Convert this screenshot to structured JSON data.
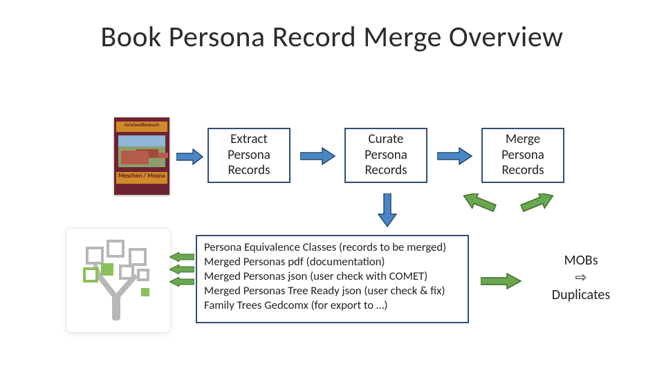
{
  "title": "Book Persona Record Merge Overview",
  "book": {
    "top_label": "Ortsfamilienbuch",
    "bottom_label": "Meschen / Moșna"
  },
  "steps": {
    "extract": {
      "l1": "Extract",
      "l2": "Persona",
      "l3": "Records"
    },
    "curate": {
      "l1": "Curate",
      "l2": "Persona",
      "l3": "Records"
    },
    "merge": {
      "l1": "Merge",
      "l2": "Persona",
      "l3": "Records"
    }
  },
  "outputs_text": "Persona Equivalence Classes (records to be merged)\nMerged Personas pdf (documentation)\nMerged Personas json (user check with COMET)\nMerged Personas Tree Ready json (user check & fix)\nFamily Trees Gedcomx (for export to …)",
  "mobs": {
    "l1": "MOBs",
    "l2": "⇨",
    "l3": "Duplicates"
  },
  "colors": {
    "arrow_blue": "#4a86c5",
    "arrow_green": "#6aa84f",
    "arrow_dark": "#244a6b",
    "border": "#2f4f74"
  }
}
